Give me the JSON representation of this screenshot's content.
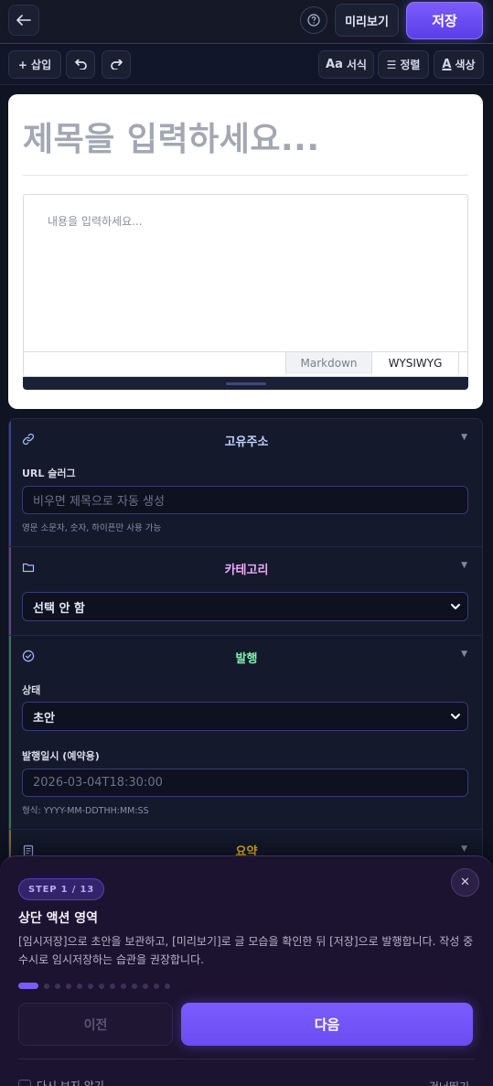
{
  "header": {
    "back_icon": "arrow-left-icon",
    "help_icon": "question-circle-icon",
    "preview_label": "미리보기",
    "save_label": "저장"
  },
  "toolbar": {
    "insert_label": "+ 삽입",
    "undo_icon": "undo-icon",
    "redo_icon": "redo-icon",
    "format_prefix": "Aa",
    "format_label": "서식",
    "align_prefix": "☰",
    "align_label": "정렬",
    "color_prefix": "A",
    "color_label": "색상"
  },
  "editor": {
    "title_placeholder": "제목을 입력하세요...",
    "content_placeholder": "내용을 입력하세요...",
    "mode_tabs": [
      "Markdown",
      "WYSIWYG"
    ],
    "active_mode": "WYSIWYG"
  },
  "sections": {
    "permalink": {
      "title": "고유주소",
      "icon": "link-icon",
      "color": "#c7d2fe",
      "url_label": "URL 슬러그",
      "url_placeholder": "비우면 제목으로 자동 생성",
      "url_hint": "영문 소문자, 숫자, 하이픈만 사용 가능"
    },
    "category": {
      "title": "카테고리",
      "icon": "folder-icon",
      "color": "#f0abfc",
      "selected": "선택 안 함"
    },
    "publish": {
      "title": "발행",
      "icon": "check-circle-icon",
      "color": "#86efac",
      "status_label": "상태",
      "status_selected": "초안",
      "date_label": "발행일시 (예약용)",
      "date_placeholder": "2026-03-04T18:30:00",
      "date_hint": "형식: YYYY-MM-DDTHH:MM:SS"
    },
    "summary": {
      "title": "요약",
      "icon": "document-icon",
      "color": "#fbbf24"
    }
  },
  "tour": {
    "step_label": "STEP 1 / 13",
    "current_step": 1,
    "total_steps": 13,
    "title": "상단 액션 영역",
    "body": "[임시저장]으로 초안을 보관하고, [미리보기]로 글 모습을 확인한 뒤 [저장]으로 발행합니다. 작성 중 수시로 임시저장하는 습관을 권장합니다.",
    "prev_label": "이전",
    "next_label": "다음",
    "dont_show_label": "다시 보지 않기",
    "skip_label": "건너뛰기",
    "close_icon": "close-icon",
    "accent_color": "#7b5cff"
  }
}
